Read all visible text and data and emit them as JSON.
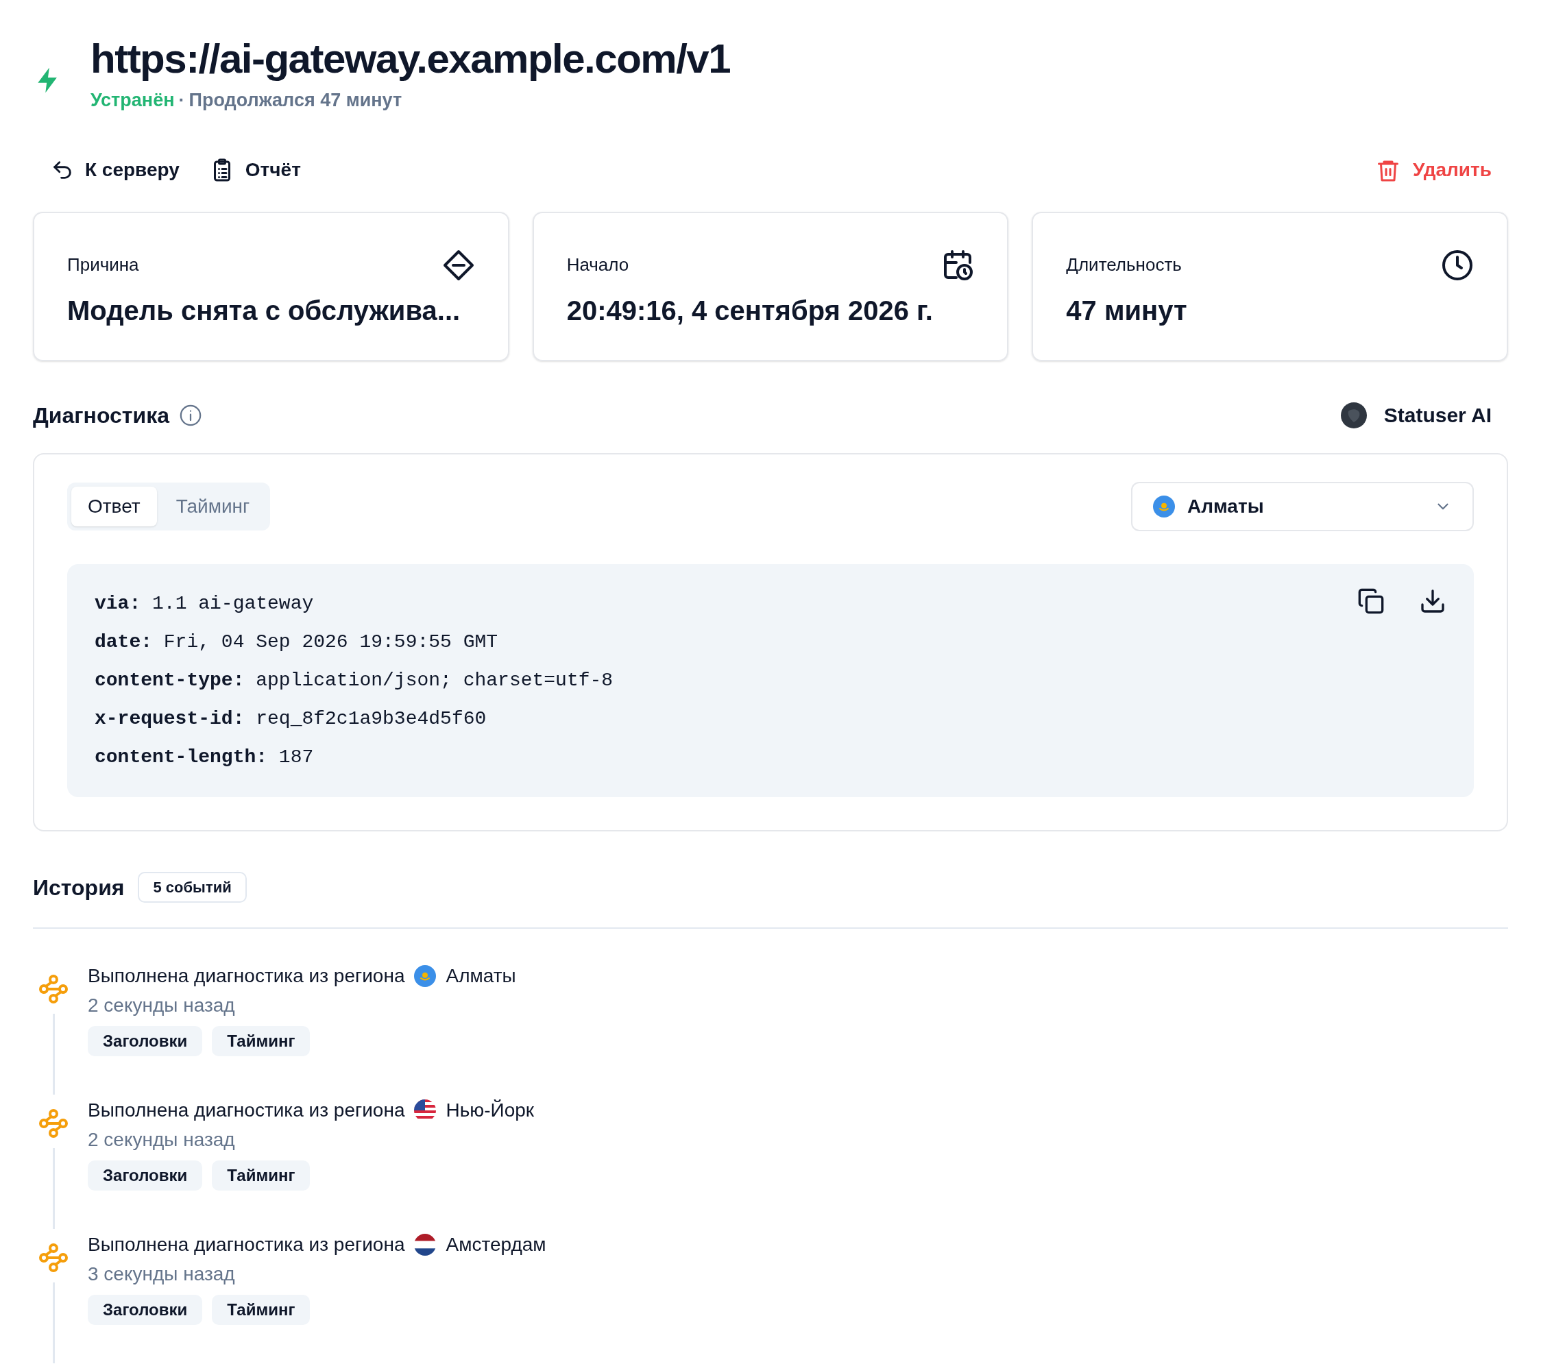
{
  "header": {
    "title": "https://ai-gateway.example.com/v1",
    "status": "Устранён",
    "separator": "·",
    "duration_text": "Продолжался 47 минут"
  },
  "toolbar": {
    "back": "К серверу",
    "report": "Отчёт",
    "delete": "Удалить"
  },
  "cards": [
    {
      "kind": "cause",
      "label": "Причина",
      "value": "Модель снята с обслужива..."
    },
    {
      "kind": "start",
      "label": "Начало",
      "value": "20:49:16, 4 сентября 2026 г."
    },
    {
      "kind": "duration",
      "label": "Длительность",
      "value": "47 минут"
    }
  ],
  "diagnostics": {
    "title": "Диагностика",
    "brand": "Statuser AI",
    "tabs": [
      {
        "label": "Ответ",
        "selected": true
      },
      {
        "label": "Тайминг",
        "selected": false
      }
    ],
    "region": {
      "kind": "kz",
      "label": "Алматы"
    },
    "lines": [
      {
        "key": "via:",
        "value": "1.1 ai-gateway"
      },
      {
        "key": "date:",
        "value": "Fri, 04 Sep 2026 19:59:55 GMT"
      },
      {
        "key": "content-type:",
        "value": "application/json; charset=utf-8"
      },
      {
        "key": "x-request-id:",
        "value": "req_8f2c1a9b3e4d5f60"
      },
      {
        "key": "content-length:",
        "value": "187"
      }
    ]
  },
  "history": {
    "title": "История",
    "count": "5 событий",
    "events": [
      {
        "text": "Выполнена диагностика из региона",
        "region": {
          "kind": "kz",
          "label": "Алматы"
        },
        "time": "2 секунды назад",
        "tags": [
          "Заголовки",
          "Тайминг"
        ]
      },
      {
        "text": "Выполнена диагностика из региона",
        "region": {
          "kind": "us",
          "label": "Нью-Йорк"
        },
        "time": "2 секунды назад",
        "tags": [
          "Заголовки",
          "Тайминг"
        ]
      },
      {
        "text": "Выполнена диагностика из региона",
        "region": {
          "kind": "nl",
          "label": "Амстердам"
        },
        "time": "3 секунды назад",
        "tags": [
          "Заголовки",
          "Тайминг"
        ]
      }
    ]
  }
}
